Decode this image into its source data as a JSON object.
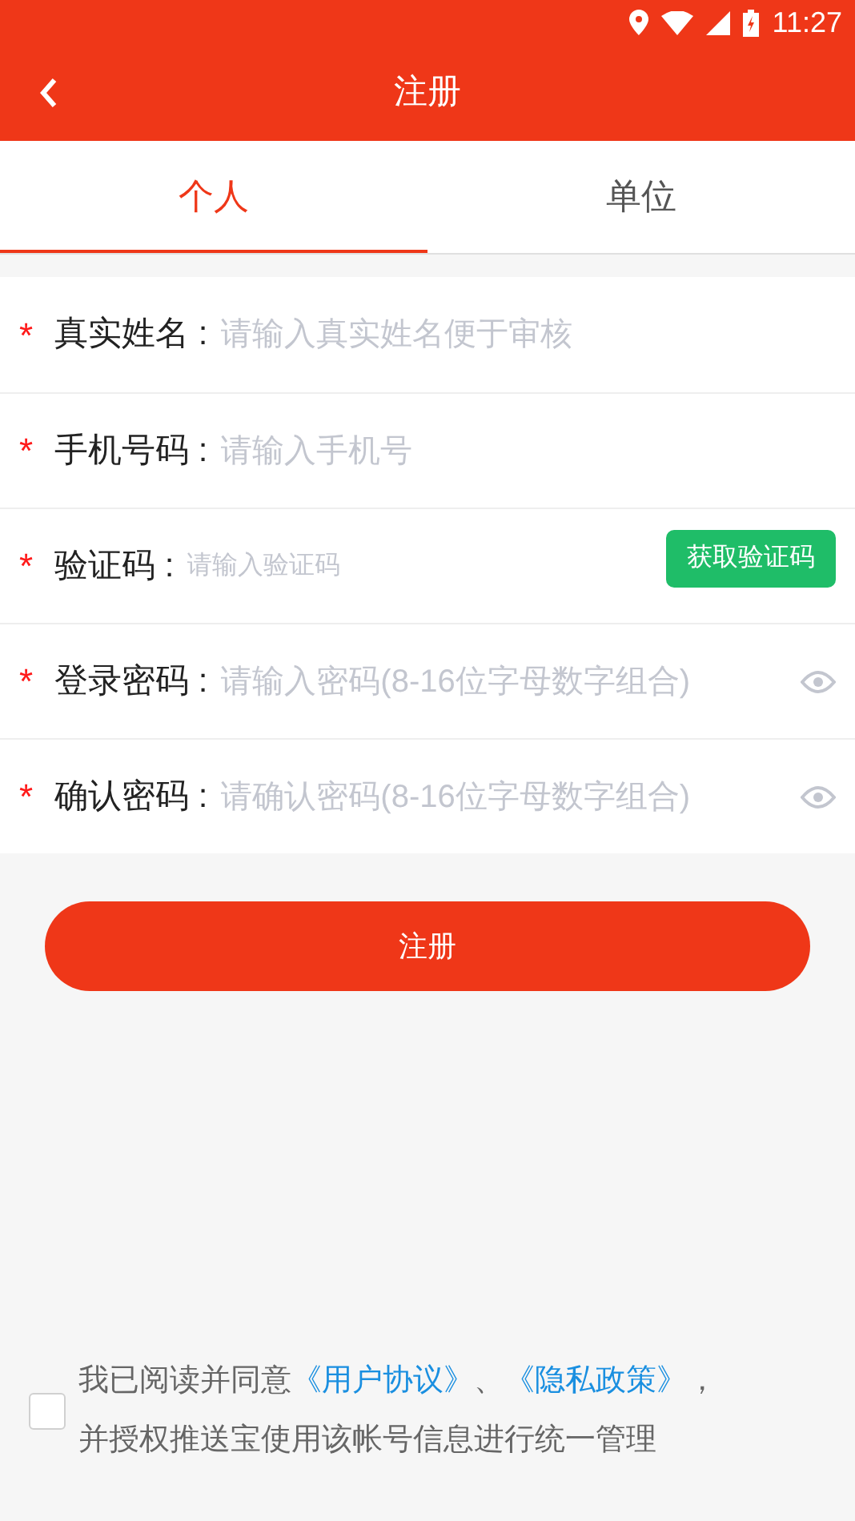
{
  "status_bar": {
    "time": "11:27"
  },
  "header": {
    "title": "注册"
  },
  "tabs": [
    {
      "label": "个人",
      "selected": true
    },
    {
      "label": "单位",
      "selected": false
    }
  ],
  "fields": [
    {
      "kind": "text",
      "mark": "*",
      "label": "真实姓名 :",
      "placeholder": "请输入真实姓名便于审核"
    },
    {
      "kind": "text",
      "mark": "*",
      "label": "手机号码 :",
      "placeholder": "请输入手机号"
    },
    {
      "kind": "code",
      "mark": "*",
      "label": "验证码 :",
      "placeholder": "请输入验证码",
      "button": "获取验证码"
    },
    {
      "kind": "password",
      "mark": "*",
      "label": "登录密码 :",
      "placeholder": "请输入密码(8-16位字母数字组合)"
    },
    {
      "kind": "password",
      "mark": "*",
      "label": "确认密码 :",
      "placeholder": "请确认密码(8-16位字母数字组合)"
    }
  ],
  "submit": "注册",
  "agreement": {
    "checked": false,
    "lead": "我已阅读并同意",
    "links": [
      "《用户协议》",
      "《隐私政策》"
    ],
    "separator": "、",
    "tail": "，",
    "line2": "并授权推送宝使用该帐号信息进行统一管理"
  }
}
